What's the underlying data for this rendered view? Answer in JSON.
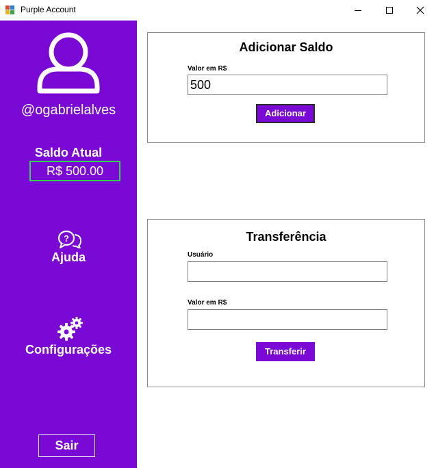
{
  "window": {
    "title": "Purple Account",
    "minimize_icon": "minimize-icon",
    "maximize_icon": "maximize-icon",
    "close_icon": "close-icon"
  },
  "sidebar": {
    "background": "#7b09d6",
    "avatar_icon": "user-avatar-icon",
    "username": "@ogabrielalves",
    "balance_label": "Saldo Atual",
    "balance_value": "R$ 500.00",
    "balance_border_color": "#35d24f",
    "help_icon": "help-chat-icon",
    "help_label": "Ajuda",
    "settings_icon": "gears-icon",
    "settings_label": "Configurações",
    "logout_label": "Sair"
  },
  "add_balance": {
    "title": "Adicionar Saldo",
    "amount_label": "Valor em R$",
    "amount_value": "500",
    "submit_label": "Adicionar"
  },
  "transfer": {
    "title": "Transferência",
    "user_label": "Usuário",
    "user_value": "",
    "amount_label": "Valor em R$",
    "amount_value": "",
    "submit_label": "Transferir"
  }
}
